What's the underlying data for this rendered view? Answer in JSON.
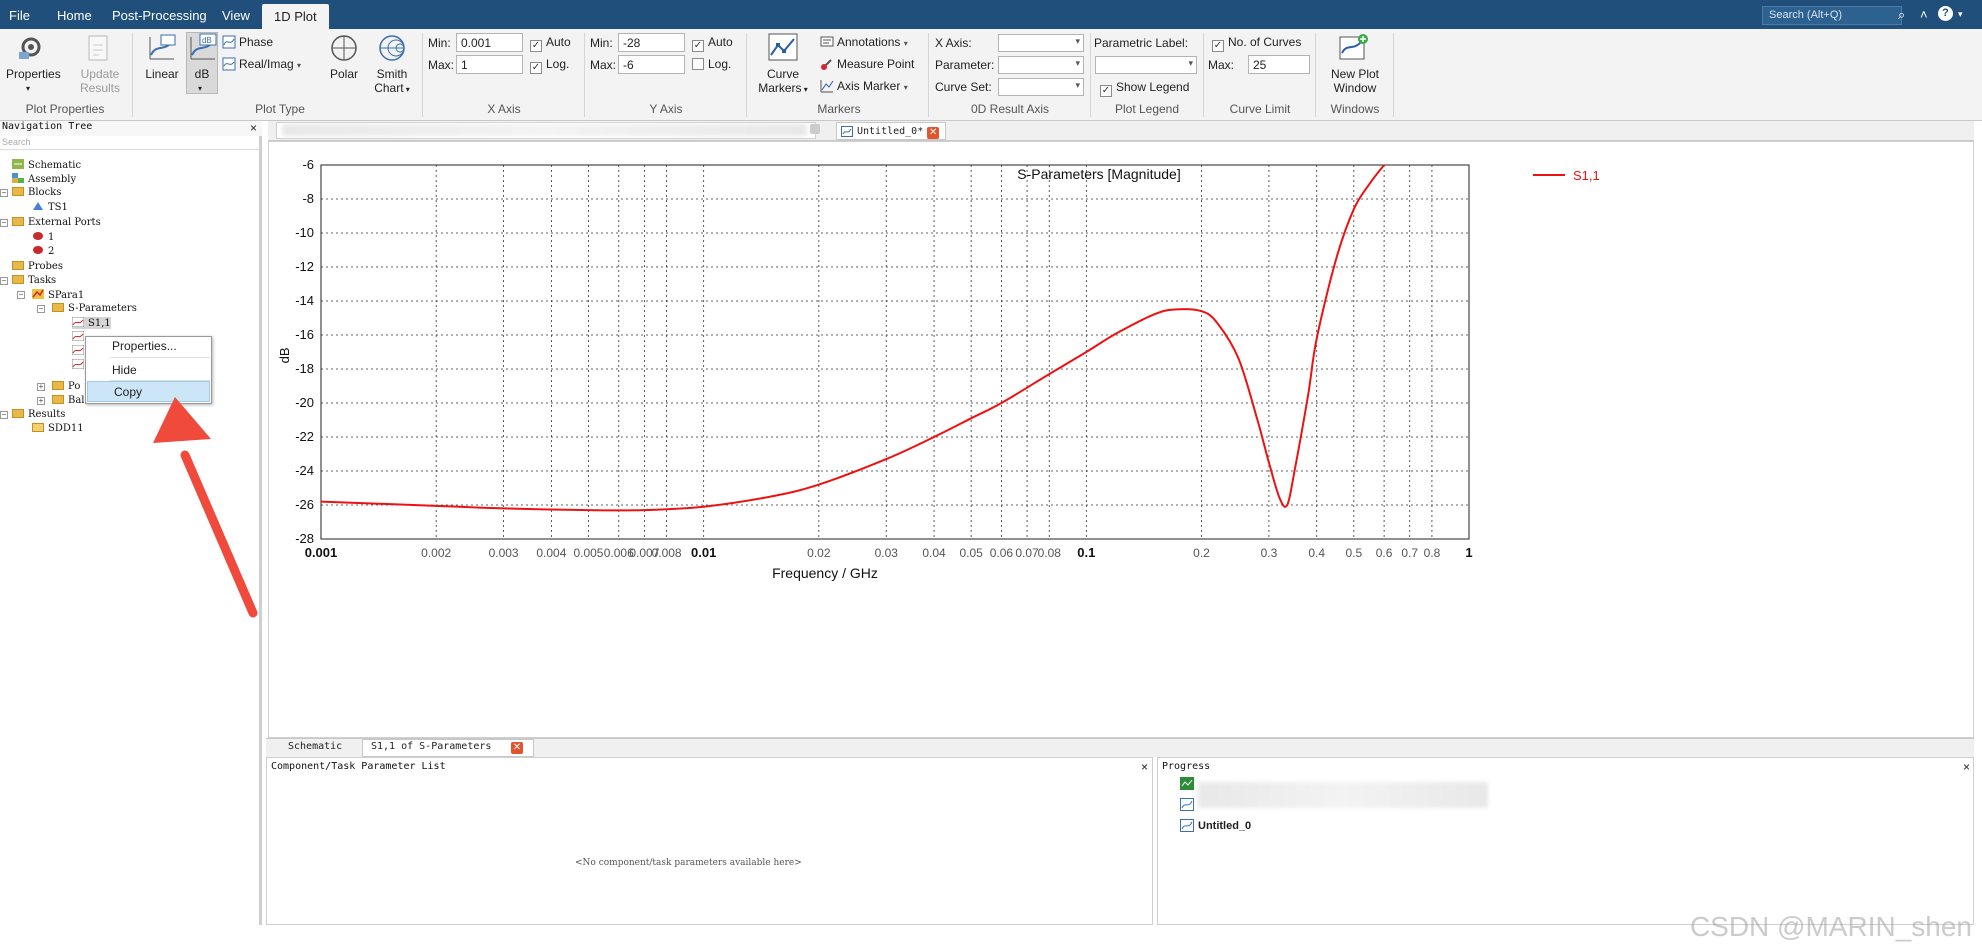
{
  "menubar": {
    "items": [
      "File",
      "Home",
      "Post-Processing",
      "View",
      "1D Plot"
    ],
    "active": "1D Plot",
    "search_placeholder": "Search (Alt+Q)"
  },
  "ribbon": {
    "plot_properties": {
      "properties": "Properties",
      "update_results_1": "Update",
      "update_results_2": "Results",
      "caption": "Plot Properties"
    },
    "plot_type": {
      "linear": "Linear",
      "db": "dB",
      "phase": "Phase",
      "real_imag": "Real/Imag",
      "polar": "Polar",
      "smith_1": "Smith",
      "smith_2": "Chart",
      "caption": "Plot Type"
    },
    "x_axis": {
      "min_label": "Min:",
      "min_value": "0.001",
      "max_label": "Max:",
      "max_value": "1",
      "auto": "Auto",
      "log": "Log.",
      "auto_checked": true,
      "log_checked": true,
      "caption": "X Axis"
    },
    "y_axis": {
      "min_label": "Min:",
      "min_value": "-28",
      "max_label": "Max:",
      "max_value": "-6",
      "auto": "Auto",
      "log": "Log.",
      "auto_checked": true,
      "log_checked": false,
      "caption": "Y Axis"
    },
    "markers": {
      "curve_markers_1": "Curve",
      "curve_markers_2": "Markers",
      "annotations": "Annotations",
      "measure_point": "Measure Point",
      "axis_marker": "Axis Marker",
      "caption": "Markers"
    },
    "od_result_axis": {
      "x_axis": "X Axis:",
      "parameter": "Parameter:",
      "curve_set": "Curve Set:",
      "caption": "0D Result Axis"
    },
    "plot_legend": {
      "parametric_label": "Parametric Label:",
      "show_legend": "Show Legend",
      "show_legend_checked": true,
      "caption": "Plot Legend"
    },
    "curve_limit": {
      "no_of_curves": "No. of Curves",
      "no_of_curves_checked": true,
      "max_label": "Max:",
      "max_value": "25",
      "caption": "Curve Limit"
    },
    "windows": {
      "new_plot_1": "New Plot",
      "new_plot_2": "Window",
      "caption": "Windows"
    }
  },
  "nav": {
    "title": "Navigation Tree",
    "search_placeholder": "Search",
    "items": {
      "schematic": "Schematic",
      "assembly": "Assembly",
      "blocks": "Blocks",
      "ts1": "TS1",
      "external_ports": "External Ports",
      "port1": "1",
      "port2": "2",
      "probes": "Probes",
      "tasks": "Tasks",
      "spara1": "SPara1",
      "s_parameters": "S-Parameters",
      "s11": "S1,1",
      "po": "Po",
      "balance": "Balance",
      "results": "Results",
      "sdd11": "SDD11"
    }
  },
  "context_menu": {
    "properties": "Properties...",
    "hide": "Hide",
    "copy": "Copy"
  },
  "doc_tabs": {
    "untitled": "Untitled_0*"
  },
  "chart_data": {
    "type": "line",
    "title": "S-Parameters [Magnitude]",
    "xlabel": "Frequency / GHz",
    "ylabel": "dB",
    "x_scale": "log",
    "xlim": [
      0.001,
      1
    ],
    "ylim": [
      -28,
      -6
    ],
    "x_ticks": [
      "0.001",
      "0.002",
      "0.003",
      "0.004",
      "0.005",
      "0.006",
      "0.007",
      "0.008",
      "0.01",
      "0.02",
      "0.03",
      "0.04",
      "0.05",
      "0.06",
      "0.07",
      "0.08",
      "0.1",
      "0.2",
      "0.3",
      "0.4",
      "0.5",
      "0.6",
      "0.7",
      "0.8",
      "1"
    ],
    "y_ticks": [
      "-6",
      "-8",
      "-10",
      "-12",
      "-14",
      "-16",
      "-18",
      "-20",
      "-22",
      "-24",
      "-26",
      "-28"
    ],
    "grid": true,
    "legend_position": "top-right",
    "series": [
      {
        "name": "S1,1",
        "color": "#ee1111",
        "x": [
          0.001,
          0.002,
          0.003,
          0.005,
          0.007,
          0.01,
          0.015,
          0.02,
          0.03,
          0.04,
          0.05,
          0.06,
          0.08,
          0.1,
          0.12,
          0.15,
          0.17,
          0.2,
          0.22,
          0.25,
          0.28,
          0.3,
          0.32,
          0.335,
          0.35,
          0.38,
          0.4,
          0.45,
          0.5,
          0.55,
          0.6
        ],
        "y": [
          -25.8,
          -26.05,
          -26.2,
          -26.3,
          -26.3,
          -26.1,
          -25.5,
          -24.8,
          -23.3,
          -22.0,
          -20.9,
          -20.0,
          -18.3,
          -17.0,
          -15.9,
          -14.8,
          -14.5,
          -14.6,
          -15.3,
          -17.4,
          -21.0,
          -23.5,
          -25.6,
          -26.0,
          -24.0,
          -19.5,
          -16.2,
          -11.5,
          -8.6,
          -7.1,
          -6.0
        ]
      }
    ]
  },
  "bottom_tabs": {
    "schematic": "Schematic",
    "s11_tab": "S1,1 of S-Parameters"
  },
  "param_panel": {
    "title": "Component/Task Parameter List",
    "empty": "<No component/task parameters available here>"
  },
  "progress_panel": {
    "title": "Progress",
    "item": "Untitled_0"
  },
  "watermark": "CSDN @MARIN_shen"
}
